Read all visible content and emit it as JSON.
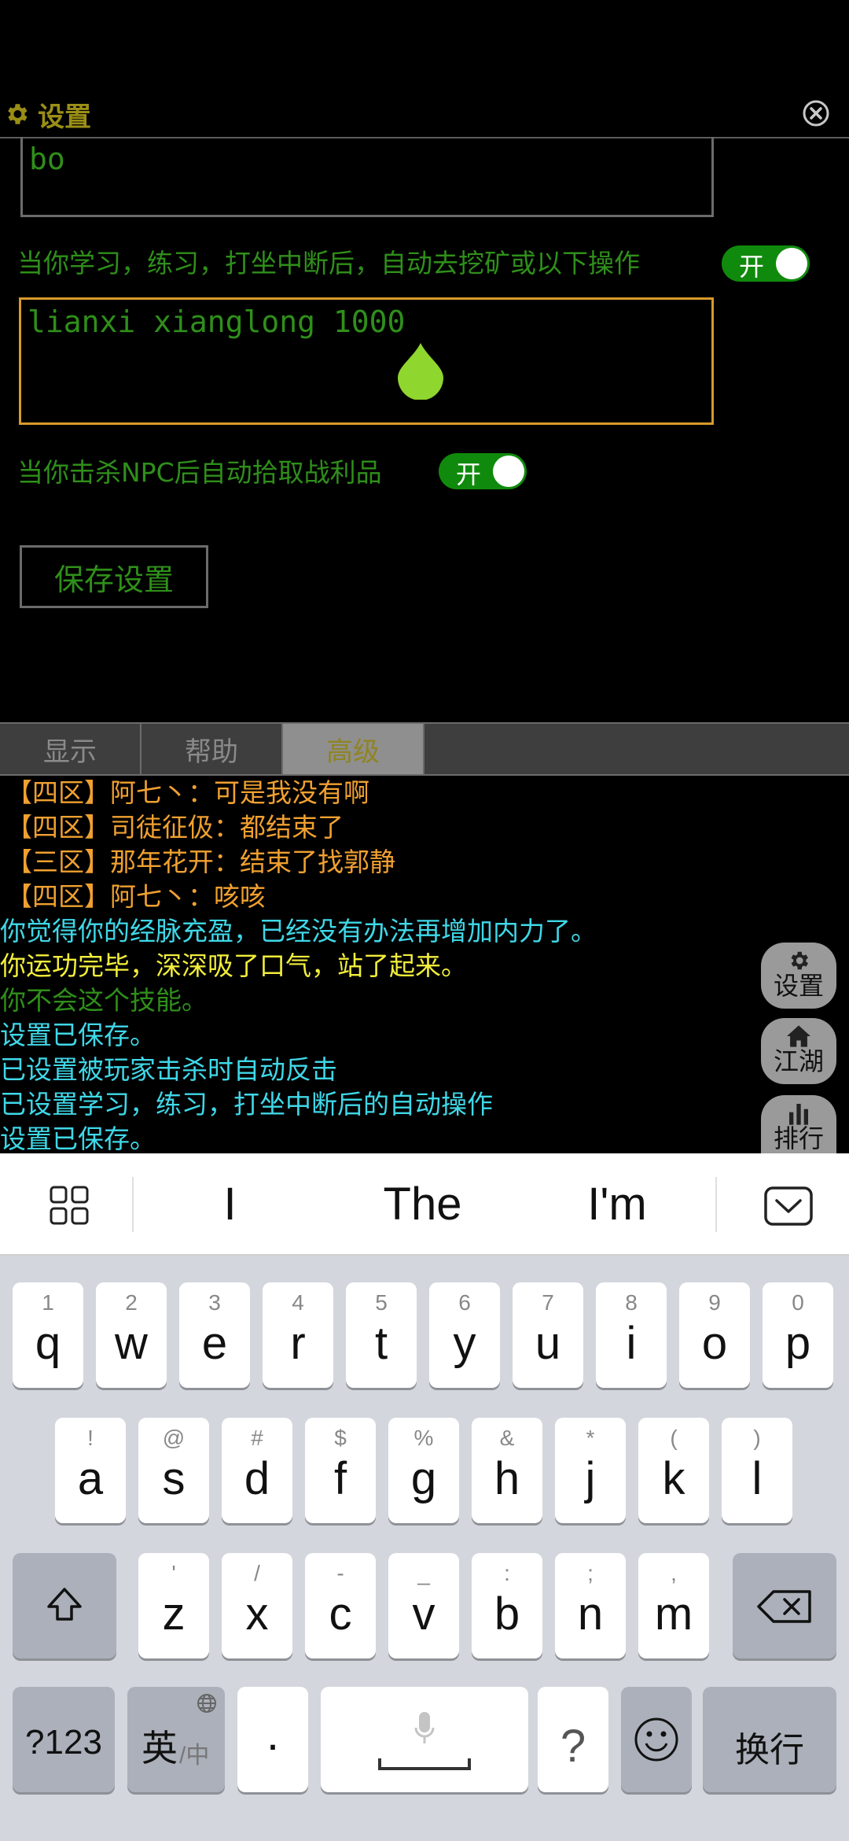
{
  "header": {
    "title": "设置"
  },
  "settings": {
    "field_top_value": "bo",
    "label_interrupt": "当你学习，练习，打坐中断后，自动去挖矿或以下操作",
    "toggle_interrupt": "开",
    "field_command_value": "lianxi xianglong 1000",
    "label_loot": "当你击杀NPC后自动拾取战利品",
    "toggle_loot": "开",
    "save_button": "保存设置"
  },
  "tabs": [
    {
      "label": "显示",
      "active": false
    },
    {
      "label": "帮助",
      "active": false
    },
    {
      "label": "高级",
      "active": true
    }
  ],
  "log": [
    {
      "text": "【四区】阿七丶：可是我没有啊",
      "color": "#f0a030"
    },
    {
      "text": "【四区】司徒征伋：都结束了",
      "color": "#f0a030"
    },
    {
      "text": "【三区】那年花开：结束了找郭静",
      "color": "#f0a030"
    },
    {
      "text": "【四区】阿七丶：咳咳",
      "color": "#f0a030"
    },
    {
      "text": "你觉得你的经脉充盈，已经没有办法再增加内力了。",
      "color": "#3fd8e8"
    },
    {
      "text": "你运功完毕，深深吸了口气，站了起来。",
      "color": "#f2ee3a"
    },
    {
      "text": "你不会这个技能。",
      "color": "#2f8f1a"
    },
    {
      "text": "设置已保存。",
      "color": "#3fd8e8"
    },
    {
      "text": "已设置被玩家击杀时自动反击",
      "color": "#3fd8e8"
    },
    {
      "text": "已设置学习，练习，打坐中断后的自动操作",
      "color": "#3fd8e8"
    },
    {
      "text": "设置已保存。",
      "color": "#3fd8e8"
    }
  ],
  "side_buttons": [
    {
      "label": "设置",
      "icon": "gear-icon"
    },
    {
      "label": "江湖",
      "icon": "home-icon"
    },
    {
      "label": "排行",
      "icon": "bar-chart-icon"
    }
  ],
  "keyboard": {
    "suggestions": [
      "I",
      "The",
      "I'm"
    ],
    "row1": [
      {
        "hint": "1",
        "key": "q"
      },
      {
        "hint": "2",
        "key": "w"
      },
      {
        "hint": "3",
        "key": "e"
      },
      {
        "hint": "4",
        "key": "r"
      },
      {
        "hint": "5",
        "key": "t"
      },
      {
        "hint": "6",
        "key": "y"
      },
      {
        "hint": "7",
        "key": "u"
      },
      {
        "hint": "8",
        "key": "i"
      },
      {
        "hint": "9",
        "key": "o"
      },
      {
        "hint": "0",
        "key": "p"
      }
    ],
    "row2": [
      {
        "hint": "!",
        "key": "a"
      },
      {
        "hint": "@",
        "key": "s"
      },
      {
        "hint": "#",
        "key": "d"
      },
      {
        "hint": "$",
        "key": "f"
      },
      {
        "hint": "%",
        "key": "g"
      },
      {
        "hint": "&",
        "key": "h"
      },
      {
        "hint": "*",
        "key": "j"
      },
      {
        "hint": "(",
        "key": "k"
      },
      {
        "hint": ")",
        "key": "l"
      }
    ],
    "row3": [
      {
        "hint": "'",
        "key": "z"
      },
      {
        "hint": "/",
        "key": "x"
      },
      {
        "hint": "-",
        "key": "c"
      },
      {
        "hint": "_",
        "key": "v"
      },
      {
        "hint": ":",
        "key": "b"
      },
      {
        "hint": ";",
        "key": "n"
      },
      {
        "hint": ",",
        "key": "m"
      }
    ],
    "num_key": "?123",
    "lang_main": "英",
    "lang_sub": "/中",
    "dot_key": "·",
    "question_key": "?",
    "enter_key": "换行"
  }
}
